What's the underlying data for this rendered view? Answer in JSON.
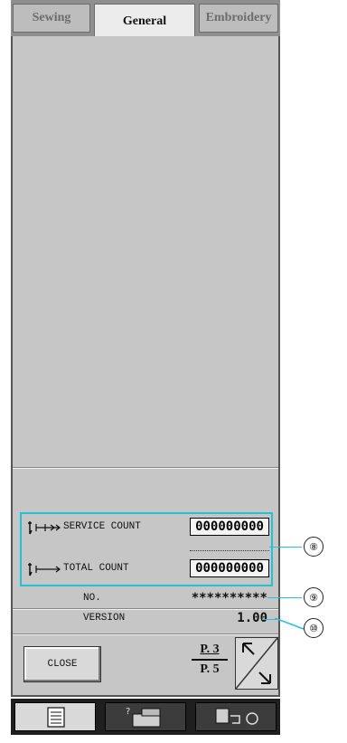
{
  "tabs": [
    {
      "label": "Sewing",
      "active": false
    },
    {
      "label": "General",
      "active": true
    },
    {
      "label": "Embroidery",
      "active": false
    }
  ],
  "counts": {
    "service_label": "SERVICE COUNT",
    "service_value": "000000000",
    "total_label": "TOTAL COUNT",
    "total_value": "000000000"
  },
  "info": {
    "no_label": "NO.",
    "no_value": "**********",
    "version_label": "VERSION",
    "version_value": "1.00"
  },
  "footer": {
    "close_label": "CLOSE",
    "page_current": "P. 3",
    "page_total": "P. 5"
  },
  "callouts": [
    "⑧",
    "⑨",
    "⑩"
  ],
  "colors": {
    "highlight": "#22c2d6",
    "panel": "#c6c6c6",
    "bottom_bar": "#1f1f1f"
  }
}
